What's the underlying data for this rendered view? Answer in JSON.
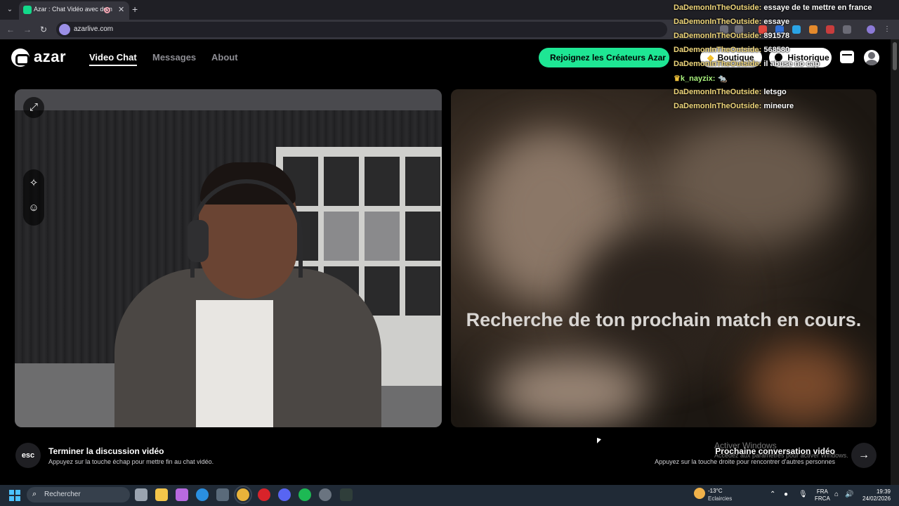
{
  "browser": {
    "tab_title": "Azar : Chat Vidéo avec de n",
    "tab_close": "✕",
    "new_tab": "+",
    "tab_list": "⌄",
    "back": "←",
    "forward": "→",
    "reload": "↻",
    "url": "azarlive.com"
  },
  "azar": {
    "logo_text": "azar",
    "nav": [
      "Video Chat",
      "Messages",
      "About"
    ],
    "creators_button": "Rejoignez les Créateurs Azar",
    "boutique_button": "Boutique",
    "historique_button": "Historique",
    "searching_text": "Recherche de ton prochain match en cours.",
    "tools": {
      "expand": "⤢",
      "magic": "✧",
      "sticker": "☺"
    },
    "controls": {
      "esc_label": "esc",
      "end_title": "Terminer la discussion vidéo",
      "end_sub": "Appuyez sur la touche échap pour mettre fin au chat vidéo.",
      "next_title": "Prochaine conversation vidéo",
      "next_sub": "Appuyez sur la touche droite pour rencontrer d'autres personnes",
      "next_arrow": "→"
    }
  },
  "chat": [
    {
      "user": "DaDemonInTheOutside:",
      "msg": "essaye de te mettre en france",
      "crown": false
    },
    {
      "user": "DaDemonInTheOutside:",
      "msg": "essaye",
      "crown": false
    },
    {
      "user": "DaDemonInTheOutside:",
      "msg": "891578",
      "crown": false
    },
    {
      "user": "DaDemonInTheOutside:",
      "msg": "568580",
      "crown": false
    },
    {
      "user": "DaDemonInTheOutside:",
      "msg": "il abuse no cap",
      "crown": false
    },
    {
      "user": "k_nayzix:",
      "msg": "🐀",
      "crown": true
    },
    {
      "user": "DaDemonInTheOutside:",
      "msg": "letsgo",
      "crown": false
    },
    {
      "user": "DaDemonInTheOutside:",
      "msg": "mineure",
      "crown": false
    }
  ],
  "windows": {
    "activate_title": "Activer Windows",
    "activate_sub": "Accédez aux paramètres pour activer Windows."
  },
  "taskbar": {
    "search_placeholder": "Rechercher",
    "search_icon": "⌕",
    "weather_temp": "-13°C",
    "weather_desc": "Eclaircies",
    "lang_top": "FRA",
    "lang_bottom": "FRCA",
    "time": "19:39",
    "date": "24/02/2026",
    "tray_up": "⌃",
    "tray_mic": "🎙",
    "tray_net": "⌂",
    "tray_vol": "🔊"
  },
  "colors": {
    "accent_green": "#1ee694",
    "chat_user": "#f0d77c",
    "browser_bg": "#35353d"
  }
}
